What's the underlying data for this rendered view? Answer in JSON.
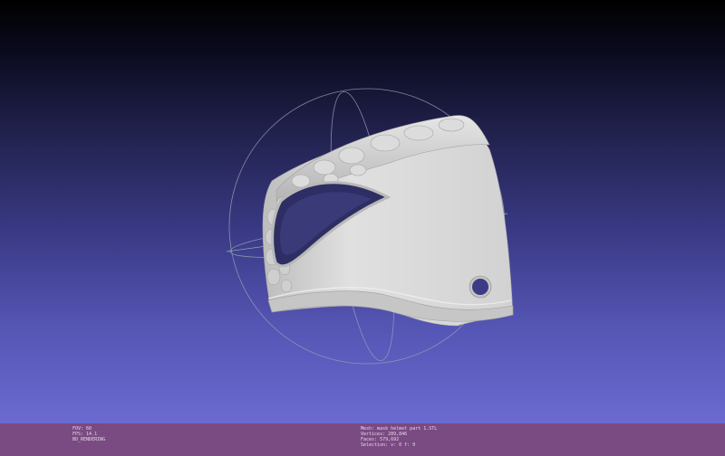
{
  "viewport": {
    "background_top": "#000000",
    "background_bottom": "#6a6ad0",
    "mesh_color": "#d9d9d9",
    "trackball_color": "#9a9ab4"
  },
  "status": {
    "left": {
      "fov": "FOV: 60",
      "fps": "FPS:   14.1",
      "render_mode": "BO_RENDERING"
    },
    "right": {
      "mesh": "Mesh: mask helmet part 1.STL",
      "vertices": "Vertices: 289,846",
      "faces": "Faces: 579,692",
      "selection": "Selection: v: 0 f: 0"
    },
    "background_color": "#7a4a82"
  }
}
